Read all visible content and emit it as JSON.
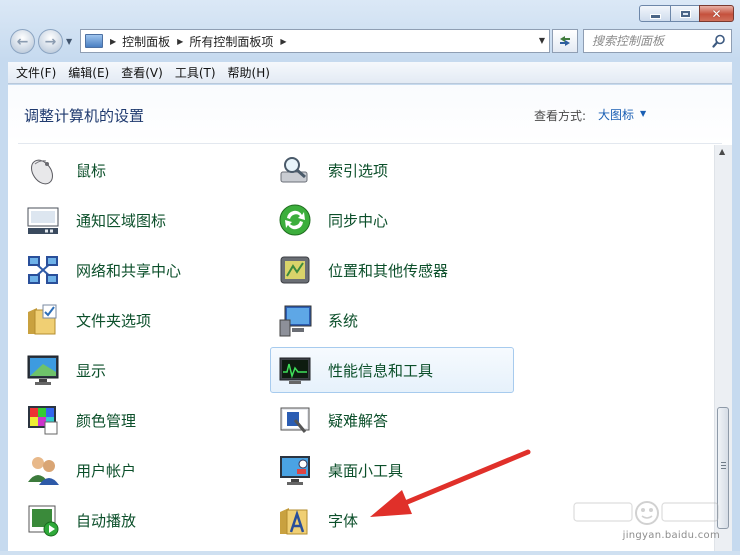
{
  "window": {
    "caption": {
      "minimize": "minimize",
      "maximize": "maximize",
      "close": "close"
    }
  },
  "address_bar": {
    "breadcrumbs": [
      "控制面板",
      "所有控制面板项"
    ]
  },
  "search": {
    "placeholder": "搜索控制面板"
  },
  "menu": [
    "文件(F)",
    "编辑(E)",
    "查看(V)",
    "工具(T)",
    "帮助(H)"
  ],
  "header": {
    "title": "调整计算机的设置",
    "view_label": "查看方式:",
    "view_value": "大图标"
  },
  "items": [
    {
      "label": "鼠标",
      "icon": "mouse-icon"
    },
    {
      "label": "索引选项",
      "icon": "indexing-options-icon"
    },
    {
      "label": "通知区域图标",
      "icon": "notification-area-icon"
    },
    {
      "label": "同步中心",
      "icon": "sync-center-icon"
    },
    {
      "label": "网络和共享中心",
      "icon": "network-sharing-icon"
    },
    {
      "label": "位置和其他传感器",
      "icon": "location-sensors-icon"
    },
    {
      "label": "文件夹选项",
      "icon": "folder-options-icon"
    },
    {
      "label": "系统",
      "icon": "system-icon"
    },
    {
      "label": "显示",
      "icon": "display-icon"
    },
    {
      "label": "性能信息和工具",
      "icon": "performance-icon"
    },
    {
      "label": "颜色管理",
      "icon": "color-management-icon"
    },
    {
      "label": "疑难解答",
      "icon": "troubleshooting-icon"
    },
    {
      "label": "用户帐户",
      "icon": "user-accounts-icon"
    },
    {
      "label": "桌面小工具",
      "icon": "desktop-gadgets-icon"
    },
    {
      "label": "自动播放",
      "icon": "autoplay-icon"
    },
    {
      "label": "字体",
      "icon": "fonts-icon"
    }
  ],
  "hovered_item": "性能信息和工具",
  "watermark": {
    "text": "jingyan.baidu.com"
  },
  "colors": {
    "label_green": "#0b4f2a",
    "title_blue": "#1f3a6f",
    "link_blue": "#1a5fb4",
    "arrow_red": "#e0302a"
  }
}
